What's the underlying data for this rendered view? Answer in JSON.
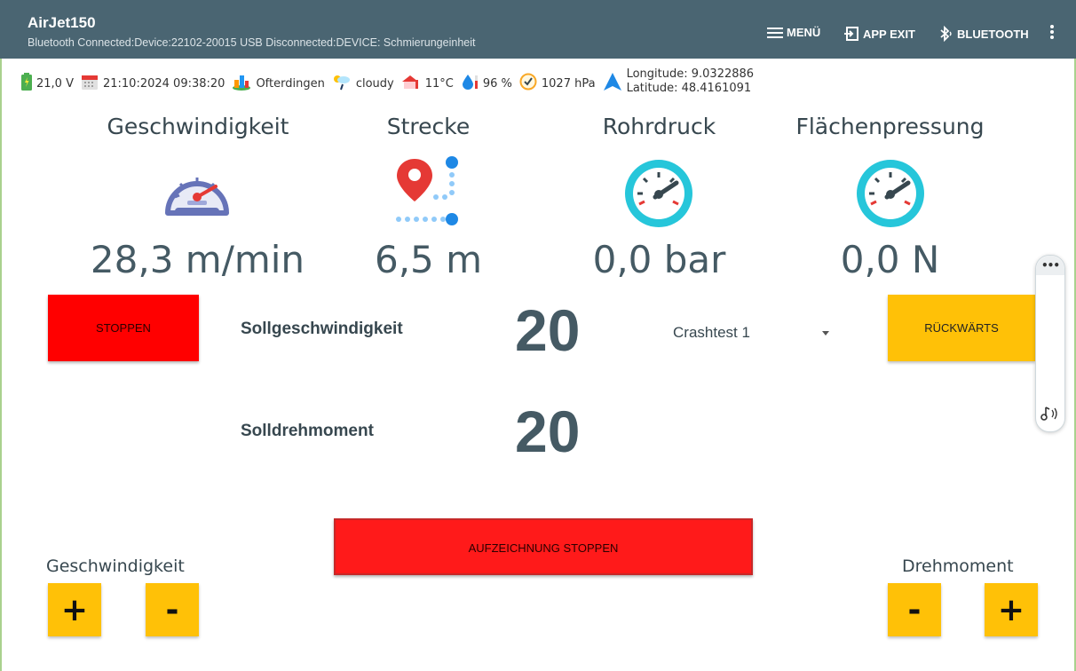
{
  "app": {
    "title": "AirJet150",
    "subtitle": "Bluetooth Connected:Device:22102-20015  USB Disconnected:DEVICE: Schmierungeinheit"
  },
  "menu": {
    "menu_label": "MENÜ",
    "exit_label": "APP EXIT",
    "bluetooth_label": "BLUETOOTH"
  },
  "status": {
    "voltage": "21,0 V",
    "datetime": "21:10:2024 09:38:20",
    "location": "Ofterdingen",
    "weather": "cloudy",
    "temperature": "11°C",
    "humidity": "96 %",
    "pressure": "1027 hPa",
    "longitude": "Longitude: 9.0322886",
    "latitude": "Latitude: 48.4161091"
  },
  "gauges": [
    {
      "title": "Geschwindigkeit",
      "value": "28,3 m/min"
    },
    {
      "title": "Strecke",
      "value": "6,5 m"
    },
    {
      "title": "Rohrdruck",
      "value": "0,0 bar"
    },
    {
      "title": "Flächenpressung",
      "value": "0,0 N"
    }
  ],
  "controls": {
    "stop_label": "STOPPEN",
    "back_label": "RÜCKWÄRTS",
    "sollgeschwindigkeit_label": "Sollgeschwindigkeit",
    "sollgeschwindigkeit_value": "20",
    "solldrehmoment_label": "Solldrehmoment",
    "solldrehmoment_value": "20",
    "program_selected": "Crashtest 1",
    "record_stop_label": "AUFZEICHNUNG STOPPEN"
  },
  "speed_section": {
    "label": "Geschwindigkeit",
    "plus": "+",
    "minus": "-"
  },
  "torque_section": {
    "label": "Drehmoment",
    "plus": "+",
    "minus": "-"
  },
  "colors": {
    "appbar": "#4a6572",
    "stop_red": "#ff0000",
    "accent_yellow": "#ffc107",
    "text_dark": "#455a64"
  }
}
